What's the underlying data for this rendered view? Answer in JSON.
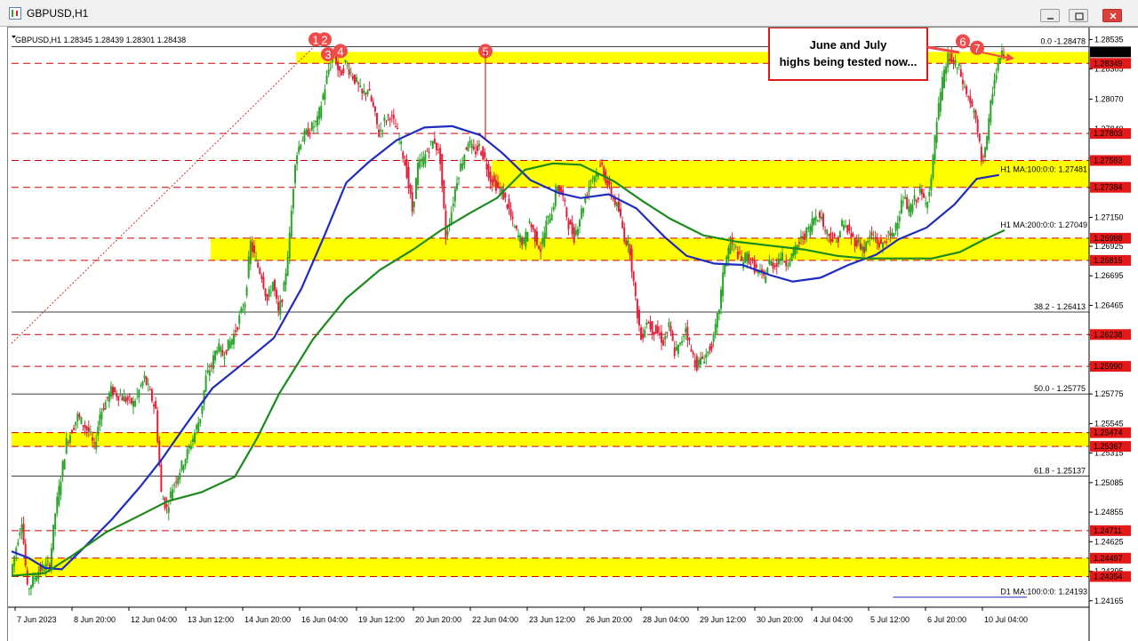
{
  "window": {
    "title": "GBPUSD,H1"
  },
  "colors": {
    "background": "#ffffff",
    "up_candle": "#2aa52a",
    "down_candle": "#e0203a",
    "ma100": "#1f2bbf",
    "ma200": "#1d8a1d",
    "zone": "#ffff00",
    "level_line": "#d00000",
    "fib_line": "#000000",
    "marker": "#f04a4a",
    "price_tag": "#e31919"
  },
  "chart_data": {
    "type": "candlestick",
    "symbol": "GBPUSD",
    "timeframe": "H1",
    "info_line": "GBPUSD,H1  1.28345 1.28439 1.28301 1.28438",
    "ylim": [
      1.24115,
      1.286
    ],
    "current_price": 1.28438,
    "x_tick_labels": [
      "7 Jun 2023",
      "8 Jun 20:00",
      "12 Jun 04:00",
      "13 Jun 12:00",
      "14 Jun 20:00",
      "16 Jun 04:00",
      "19 Jun 12:00",
      "20 Jun 20:00",
      "22 Jun 04:00",
      "23 Jun 12:00",
      "26 Jun 20:00",
      "28 Jun 04:00",
      "29 Jun 12:00",
      "30 Jun 20:00",
      "4 Jul 04:00",
      "5 Jul 12:00",
      "6 Jul 20:00",
      "10 Jul 04:00"
    ],
    "y_tick_labels": [
      1.28535,
      1.28305,
      1.2807,
      1.2784,
      1.2761,
      1.2738,
      1.2715,
      1.26925,
      1.26695,
      1.26465,
      1.26235,
      1.26005,
      1.25775,
      1.25545,
      1.25315,
      1.25085,
      1.24855,
      1.24625,
      1.24395,
      1.24165
    ],
    "price_tags": [
      1.28438,
      1.28349,
      1.27803,
      1.27593,
      1.27384,
      1.26988,
      1.26815,
      1.26238,
      1.2599,
      1.25474,
      1.25367,
      1.24711,
      1.24497,
      1.24354
    ],
    "horizontal_levels": [
      1.28349,
      1.27803,
      1.27593,
      1.27384,
      1.26988,
      1.26815,
      1.26238,
      1.2599,
      1.25474,
      1.25367,
      1.24711,
      1.24497,
      1.24354
    ],
    "zones": [
      {
        "top": 1.28438,
        "bottom": 1.28349
      },
      {
        "top": 1.27593,
        "bottom": 1.27384
      },
      {
        "top": 1.26988,
        "bottom": 1.26815
      },
      {
        "top": 1.25474,
        "bottom": 1.25367
      },
      {
        "top": 1.24497,
        "bottom": 1.24354
      }
    ],
    "fib_levels": [
      {
        "label": "0.0 -1.28478",
        "value": 1.28478
      },
      {
        "label": "38.2 - 1.26413",
        "value": 1.26413
      },
      {
        "label": "50.0 - 1.25775",
        "value": 1.25775
      },
      {
        "label": "61.8 - 1.25137",
        "value": 1.25137
      }
    ],
    "moving_averages": [
      {
        "label": "H1 MA:100:0:0: 1.27481",
        "value": 1.27481,
        "color": "#1f2bbf",
        "points": [
          [
            0,
            1.2455
          ],
          [
            3,
            1.245
          ],
          [
            6,
            1.2442
          ],
          [
            9,
            1.2441
          ],
          [
            13,
            1.2458
          ],
          [
            18,
            1.248
          ],
          [
            23,
            1.2505
          ],
          [
            27,
            1.2527
          ],
          [
            31,
            1.2552
          ],
          [
            36,
            1.2582
          ],
          [
            42,
            1.2603
          ],
          [
            47,
            1.2621
          ],
          [
            52,
            1.266
          ],
          [
            56,
            1.27
          ],
          [
            60,
            1.2742
          ],
          [
            64,
            1.2758
          ],
          [
            69,
            1.2775
          ],
          [
            74,
            1.2785
          ],
          [
            79,
            1.2786
          ],
          [
            84,
            1.2779
          ],
          [
            88,
            1.2765
          ],
          [
            93,
            1.2744
          ],
          [
            98,
            1.2734
          ],
          [
            102,
            1.273
          ],
          [
            107,
            1.2733
          ],
          [
            112,
            1.2722
          ],
          [
            117,
            1.27
          ],
          [
            121,
            1.2685
          ],
          [
            126,
            1.2679
          ],
          [
            131,
            1.2678
          ],
          [
            136,
            1.267
          ],
          [
            140,
            1.2665
          ],
          [
            145,
            1.2668
          ],
          [
            150,
            1.2678
          ],
          [
            155,
            1.2686
          ],
          [
            159,
            1.2698
          ],
          [
            164,
            1.2707
          ],
          [
            169,
            1.2725
          ],
          [
            173,
            1.2745
          ],
          [
            177,
            1.2748
          ]
        ]
      },
      {
        "label": "H1 MA:200:0:0: 1.27049",
        "value": 1.27049,
        "color": "#1d8a1d",
        "points": [
          [
            0,
            1.2436
          ],
          [
            6,
            1.2438
          ],
          [
            11,
            1.2452
          ],
          [
            17,
            1.247
          ],
          [
            23,
            1.2483
          ],
          [
            28,
            1.2494
          ],
          [
            34,
            1.2501
          ],
          [
            40,
            1.2513
          ],
          [
            44,
            1.2543
          ],
          [
            48,
            1.2578
          ],
          [
            54,
            1.262
          ],
          [
            60,
            1.2652
          ],
          [
            66,
            1.2674
          ],
          [
            72,
            1.269
          ],
          [
            77,
            1.2705
          ],
          [
            82,
            1.2718
          ],
          [
            87,
            1.273
          ],
          [
            92,
            1.2752
          ],
          [
            97,
            1.2757
          ],
          [
            102,
            1.2756
          ],
          [
            108,
            1.2743
          ],
          [
            113,
            1.2728
          ],
          [
            118,
            1.2714
          ],
          [
            124,
            1.2701
          ],
          [
            130,
            1.2696
          ],
          [
            136,
            1.2693
          ],
          [
            142,
            1.269
          ],
          [
            148,
            1.2685
          ],
          [
            153,
            1.2683
          ],
          [
            159,
            1.2683
          ],
          [
            165,
            1.2683
          ],
          [
            170,
            1.2688
          ],
          [
            174,
            1.2697
          ],
          [
            178,
            1.2705
          ]
        ]
      },
      {
        "label": "D1 MA:100:0:0: 1.24193",
        "value": 1.24193,
        "color": "#1f2bbf",
        "points": [
          [
            158,
            1.24193
          ],
          [
            182,
            1.24193
          ]
        ]
      }
    ],
    "markers": [
      "1",
      "2",
      "3",
      "4",
      "5",
      "6",
      "7"
    ],
    "annotation": "June and July highs being tested now...",
    "path_points": [
      [
        0,
        1.2437
      ],
      [
        2,
        1.248
      ],
      [
        3,
        1.2425
      ],
      [
        5,
        1.244
      ],
      [
        7,
        1.2445
      ],
      [
        8,
        1.2485
      ],
      [
        10,
        1.254
      ],
      [
        12,
        1.256
      ],
      [
        14,
        1.2548
      ],
      [
        15,
        1.2535
      ],
      [
        16,
        1.2562
      ],
      [
        18,
        1.258
      ],
      [
        20,
        1.2575
      ],
      [
        22,
        1.257
      ],
      [
        24,
        1.259
      ],
      [
        26,
        1.2565
      ],
      [
        27,
        1.25
      ],
      [
        28,
        1.2488
      ],
      [
        29,
        1.2505
      ],
      [
        30,
        1.2515
      ],
      [
        32,
        1.2535
      ],
      [
        34,
        1.256
      ],
      [
        35,
        1.259
      ],
      [
        36,
        1.26
      ],
      [
        37,
        1.2615
      ],
      [
        38,
        1.2608
      ],
      [
        40,
        1.2623
      ],
      [
        42,
        1.265
      ],
      [
        43,
        1.2695
      ],
      [
        44,
        1.268
      ],
      [
        45,
        1.267
      ],
      [
        46,
        1.265
      ],
      [
        47,
        1.2665
      ],
      [
        48,
        1.264
      ],
      [
        49,
        1.266
      ],
      [
        50,
        1.27
      ],
      [
        51,
        1.276
      ],
      [
        52,
        1.2775
      ],
      [
        53,
        1.278
      ],
      [
        55,
        1.279
      ],
      [
        56,
        1.281
      ],
      [
        57,
        1.283
      ],
      [
        58,
        1.2842
      ],
      [
        59,
        1.2825
      ],
      [
        60,
        1.2835
      ],
      [
        62,
        1.282
      ],
      [
        63,
        1.281
      ],
      [
        64,
        1.2815
      ],
      [
        65,
        1.28
      ],
      [
        66,
        1.278
      ],
      [
        67,
        1.279
      ],
      [
        68,
        1.2795
      ],
      [
        69,
        1.2785
      ],
      [
        70,
        1.277
      ],
      [
        71,
        1.275
      ],
      [
        72,
        1.272
      ],
      [
        73,
        1.2755
      ],
      [
        74,
        1.276
      ],
      [
        75,
        1.277
      ],
      [
        76,
        1.2775
      ],
      [
        77,
        1.276
      ],
      [
        78,
        1.27
      ],
      [
        79,
        1.272
      ],
      [
        80,
        1.2745
      ],
      [
        81,
        1.276
      ],
      [
        82,
        1.2775
      ],
      [
        83,
        1.2765
      ],
      [
        84,
        1.277
      ],
      [
        85,
        1.276
      ],
      [
        86,
        1.2745
      ],
      [
        87,
        1.274
      ],
      [
        88,
        1.2735
      ],
      [
        89,
        1.2725
      ],
      [
        90,
        1.271
      ],
      [
        91,
        1.27
      ],
      [
        92,
        1.2695
      ],
      [
        93,
        1.2712
      ],
      [
        94,
        1.27
      ],
      [
        95,
        1.269
      ],
      [
        96,
        1.271
      ],
      [
        97,
        1.272
      ],
      [
        98,
        1.274
      ],
      [
        99,
        1.273
      ],
      [
        100,
        1.271
      ],
      [
        101,
        1.27
      ],
      [
        102,
        1.2715
      ],
      [
        103,
        1.273
      ],
      [
        104,
        1.2745
      ],
      [
        105,
        1.275
      ],
      [
        106,
        1.2755
      ],
      [
        107,
        1.274
      ],
      [
        108,
        1.273
      ],
      [
        109,
        1.272
      ],
      [
        110,
        1.27
      ],
      [
        111,
        1.269
      ],
      [
        112,
        1.265
      ],
      [
        113,
        1.262
      ],
      [
        114,
        1.2635
      ],
      [
        115,
        1.2628
      ],
      [
        116,
        1.2625
      ],
      [
        117,
        1.2618
      ],
      [
        118,
        1.263
      ],
      [
        119,
        1.261
      ],
      [
        120,
        1.2615
      ],
      [
        121,
        1.263
      ],
      [
        122,
        1.261
      ],
      [
        123,
        1.26
      ],
      [
        124,
        1.2605
      ],
      [
        125,
        1.261
      ],
      [
        126,
        1.262
      ],
      [
        127,
        1.2645
      ],
      [
        128,
        1.268
      ],
      [
        129,
        1.2695
      ],
      [
        130,
        1.269
      ],
      [
        131,
        1.268
      ],
      [
        132,
        1.2685
      ],
      [
        133,
        1.2678
      ],
      [
        134,
        1.2672
      ],
      [
        135,
        1.2668
      ],
      [
        136,
        1.268
      ],
      [
        137,
        1.2678
      ],
      [
        138,
        1.2685
      ],
      [
        139,
        1.268
      ],
      [
        140,
        1.2685
      ],
      [
        141,
        1.2693
      ],
      [
        142,
        1.27
      ],
      [
        143,
        1.2705
      ],
      [
        144,
        1.2715
      ],
      [
        145,
        1.2718
      ],
      [
        146,
        1.2705
      ],
      [
        147,
        1.27
      ],
      [
        148,
        1.2695
      ],
      [
        149,
        1.271
      ],
      [
        150,
        1.2705
      ],
      [
        151,
        1.2698
      ],
      [
        152,
        1.2695
      ],
      [
        153,
        1.269
      ],
      [
        154,
        1.27
      ],
      [
        155,
        1.2698
      ],
      [
        156,
        1.2692
      ],
      [
        157,
        1.27
      ],
      [
        158,
        1.27
      ],
      [
        159,
        1.2715
      ],
      [
        160,
        1.273
      ],
      [
        161,
        1.272
      ],
      [
        162,
        1.2728
      ],
      [
        163,
        1.2735
      ],
      [
        164,
        1.2725
      ],
      [
        165,
        1.2745
      ],
      [
        166,
        1.279
      ],
      [
        167,
        1.282
      ],
      [
        168,
        1.284
      ],
      [
        169,
        1.2835
      ],
      [
        170,
        1.283
      ],
      [
        171,
        1.2815
      ],
      [
        172,
        1.2805
      ],
      [
        173,
        1.279
      ],
      [
        174,
        1.276
      ],
      [
        175,
        1.2775
      ],
      [
        176,
        1.2815
      ],
      [
        177,
        1.2835
      ],
      [
        178,
        1.2844
      ]
    ]
  }
}
